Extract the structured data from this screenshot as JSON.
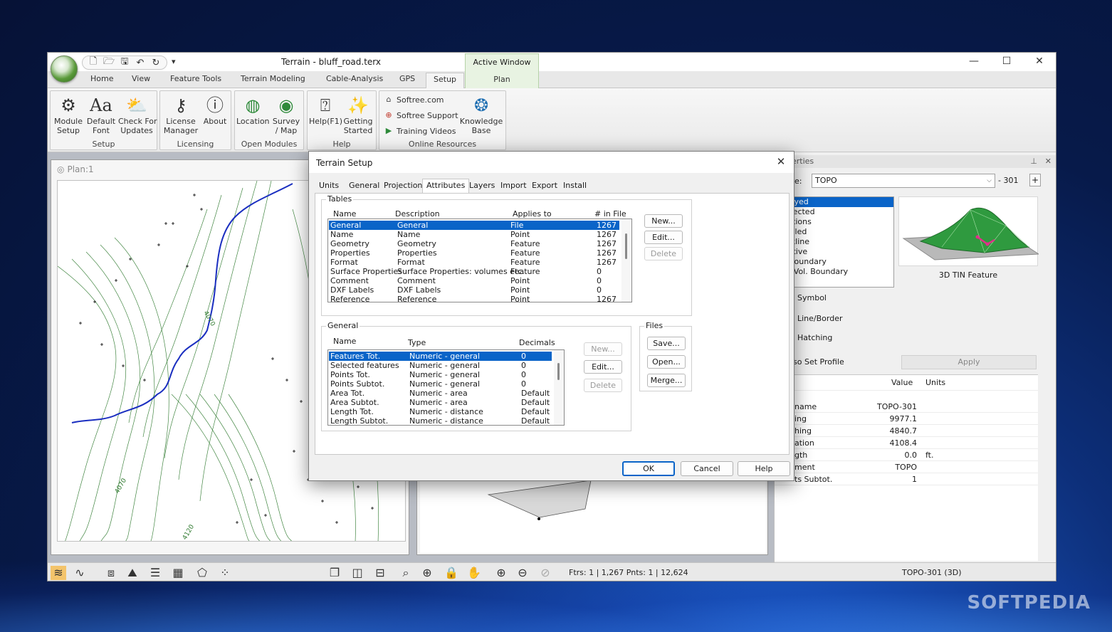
{
  "desktop": {
    "watermark": "SOFTPEDIA"
  },
  "window": {
    "title": "Terrain - bluff_road.terx",
    "context_tab_header": "Active Window",
    "controls": {
      "minimize": "—",
      "maximize": "☐",
      "close": "✕"
    }
  },
  "qat": {
    "icons": [
      "new-file-icon",
      "open-folder-icon",
      "save-icon",
      "undo-icon",
      "redo-icon"
    ],
    "more": "▾"
  },
  "ribbon_tabs": [
    "Home",
    "View",
    "Feature Tools",
    "Terrain Modeling",
    "Cable-Analysis",
    "GPS",
    "Setup",
    "Plan"
  ],
  "ribbon": {
    "setup": {
      "label": "Setup",
      "module_setup": "Module\nSetup",
      "default_font": "Default\nFont",
      "check_updates": "Check For\nUpdates"
    },
    "licensing": {
      "label": "Licensing",
      "license_manager": "License\nManager",
      "about": "About"
    },
    "open_modules": {
      "label": "Open Modules",
      "location": "Location",
      "survey_map": "Survey\n/ Map"
    },
    "help": {
      "label": "Help",
      "help_f1": "Help(F1)",
      "getting_started": "Getting\nStarted"
    },
    "online": {
      "label": "Online Resources",
      "softree": "Softree.com",
      "support": "Softree Support",
      "videos": "Training Videos",
      "kb": "Knowledge\nBase"
    }
  },
  "plan_view": {
    "title": "Plan:1",
    "contour_labels": [
      "4070",
      "4070",
      "4120"
    ]
  },
  "properties": {
    "title_partial": "erties",
    "type_label_partial": "e:",
    "type_value": "TOPO",
    "type_suffix": "- 301",
    "plus": "+",
    "features": [
      "splayed",
      "onnected",
      "evations",
      "odelled",
      "reakline",
      "egative",
      "IN Boundary",
      "urf./Vol. Boundary"
    ],
    "preview_caption": "3D TIN Feature",
    "options": [
      "Symbol",
      "Line/Border",
      "Hatching",
      "so Set Profile"
    ],
    "apply": "Apply",
    "grid_headers": {
      "value": "Value",
      "units": "Units"
    },
    "grid_rows": [
      {
        "name": "name",
        "value": "TOPO-301",
        "units": ""
      },
      {
        "name": "ing",
        "value": "9977.1",
        "units": ""
      },
      {
        "name": "hing",
        "value": "4840.7",
        "units": ""
      },
      {
        "name": "ation",
        "value": "4108.4",
        "units": ""
      },
      {
        "name": "gth",
        "value": "0.0",
        "units": "ft."
      },
      {
        "name": "ment",
        "value": "TOPO",
        "units": ""
      },
      {
        "name": "ts Subtot.",
        "value": "1",
        "units": ""
      }
    ]
  },
  "statusbar": {
    "counts": "Ftrs: 1 | 1,267  Pnts: 1 | 12,624",
    "feature": "TOPO-301 (3D)"
  },
  "dialog": {
    "title": "Terrain Setup",
    "tabs": [
      "Units",
      "General",
      "Projection",
      "Attributes",
      "Layers",
      "Import",
      "Export",
      "Install"
    ],
    "active_tab": "Attributes",
    "tables": {
      "label": "Tables",
      "headers": [
        "Name",
        "Description",
        "Applies to",
        "# in File"
      ],
      "rows": [
        [
          "General",
          "General",
          "File",
          "1267"
        ],
        [
          "Name",
          "Name",
          "Point",
          "1267"
        ],
        [
          "Geometry",
          "Geometry",
          "Feature",
          "1267"
        ],
        [
          "Properties",
          "Properties",
          "Feature",
          "1267"
        ],
        [
          "Format",
          "Format",
          "Feature",
          "1267"
        ],
        [
          "Surface Properties",
          "Surface Properties: volumes etc.",
          "Feature",
          "0"
        ],
        [
          "Comment",
          "Comment",
          "Point",
          "0"
        ],
        [
          "DXF Labels",
          "DXF Labels",
          "Point",
          "0"
        ],
        [
          "Reference",
          "Reference",
          "Point",
          "1267"
        ]
      ],
      "buttons": {
        "new": "New...",
        "edit": "Edit...",
        "delete": "Delete"
      }
    },
    "general": {
      "label": "General",
      "headers": [
        "Name",
        "Type",
        "Decimals"
      ],
      "rows": [
        [
          "Features Tot.",
          "Numeric - general",
          "0"
        ],
        [
          "Selected features",
          "Numeric - general",
          "0"
        ],
        [
          "Points Tot.",
          "Numeric - general",
          "0"
        ],
        [
          "Points Subtot.",
          "Numeric - general",
          "0"
        ],
        [
          "Area Tot.",
          "Numeric - area",
          "Default"
        ],
        [
          "Area Subtot.",
          "Numeric - area",
          "Default"
        ],
        [
          "Length Tot.",
          "Numeric - distance",
          "Default"
        ],
        [
          "Length Subtot.",
          "Numeric - distance",
          "Default"
        ]
      ],
      "buttons": {
        "new": "New...",
        "edit": "Edit...",
        "delete": "Delete"
      }
    },
    "files": {
      "label": "Files",
      "save": "Save...",
      "open": "Open...",
      "merge": "Merge..."
    },
    "footer": {
      "ok": "OK",
      "cancel": "Cancel",
      "help": "Help"
    }
  }
}
